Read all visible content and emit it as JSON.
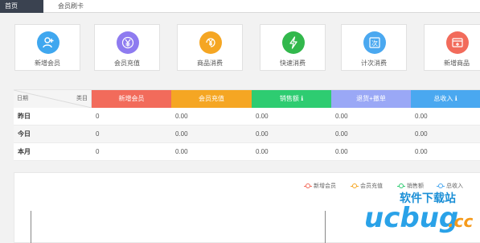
{
  "tabs": [
    {
      "label": "首页"
    },
    {
      "label": "会员刷卡"
    }
  ],
  "tiles": [
    {
      "label": "新增会员",
      "color": "#3fa7ef",
      "icon": "add-member-icon"
    },
    {
      "label": "会员充值",
      "color": "#8e7bf0",
      "icon": "yen-recharge-icon"
    },
    {
      "label": "商品消费",
      "color": "#f5a623",
      "icon": "yen-consume-icon"
    },
    {
      "label": "快速消费",
      "color": "#32b84c",
      "icon": "lightning-icon"
    },
    {
      "label": "计次消费",
      "color": "#4aa8f0",
      "icon": "count-card-icon"
    },
    {
      "label": "新增商品",
      "color": "#f26b5b",
      "icon": "add-goods-icon"
    }
  ],
  "table": {
    "corner_left": "日期",
    "corner_right": "类目",
    "columns": [
      {
        "label": "新增会员",
        "color": "#f26b5b"
      },
      {
        "label": "会员充值",
        "color": "#f5a623"
      },
      {
        "label": "销售额 ℹ",
        "color": "#2ecc71"
      },
      {
        "label": "退货+撤单",
        "color": "#9aa8f6"
      },
      {
        "label": "总收入 ℹ",
        "color": "#4aa8f0"
      }
    ],
    "rows": [
      {
        "date": "昨日",
        "values": [
          "0",
          "0.00",
          "0.00",
          "0.00",
          "0.00"
        ]
      },
      {
        "date": "今日",
        "values": [
          "0",
          "0.00",
          "0.00",
          "0.00",
          "0.00"
        ]
      },
      {
        "date": "本月",
        "values": [
          "0",
          "0.00",
          "0.00",
          "0.00",
          "0.00"
        ]
      }
    ]
  },
  "chart_legend": [
    {
      "label": "新增会员",
      "color": "#f26b5b"
    },
    {
      "label": "会员充值",
      "color": "#f5a623"
    },
    {
      "label": "销售额",
      "color": "#2ecc71"
    },
    {
      "label": "总收入",
      "color": "#4aa8f0"
    }
  ],
  "watermark": {
    "cn": "软件下载站",
    "brand": "ucbug",
    "tld": ".cc"
  }
}
